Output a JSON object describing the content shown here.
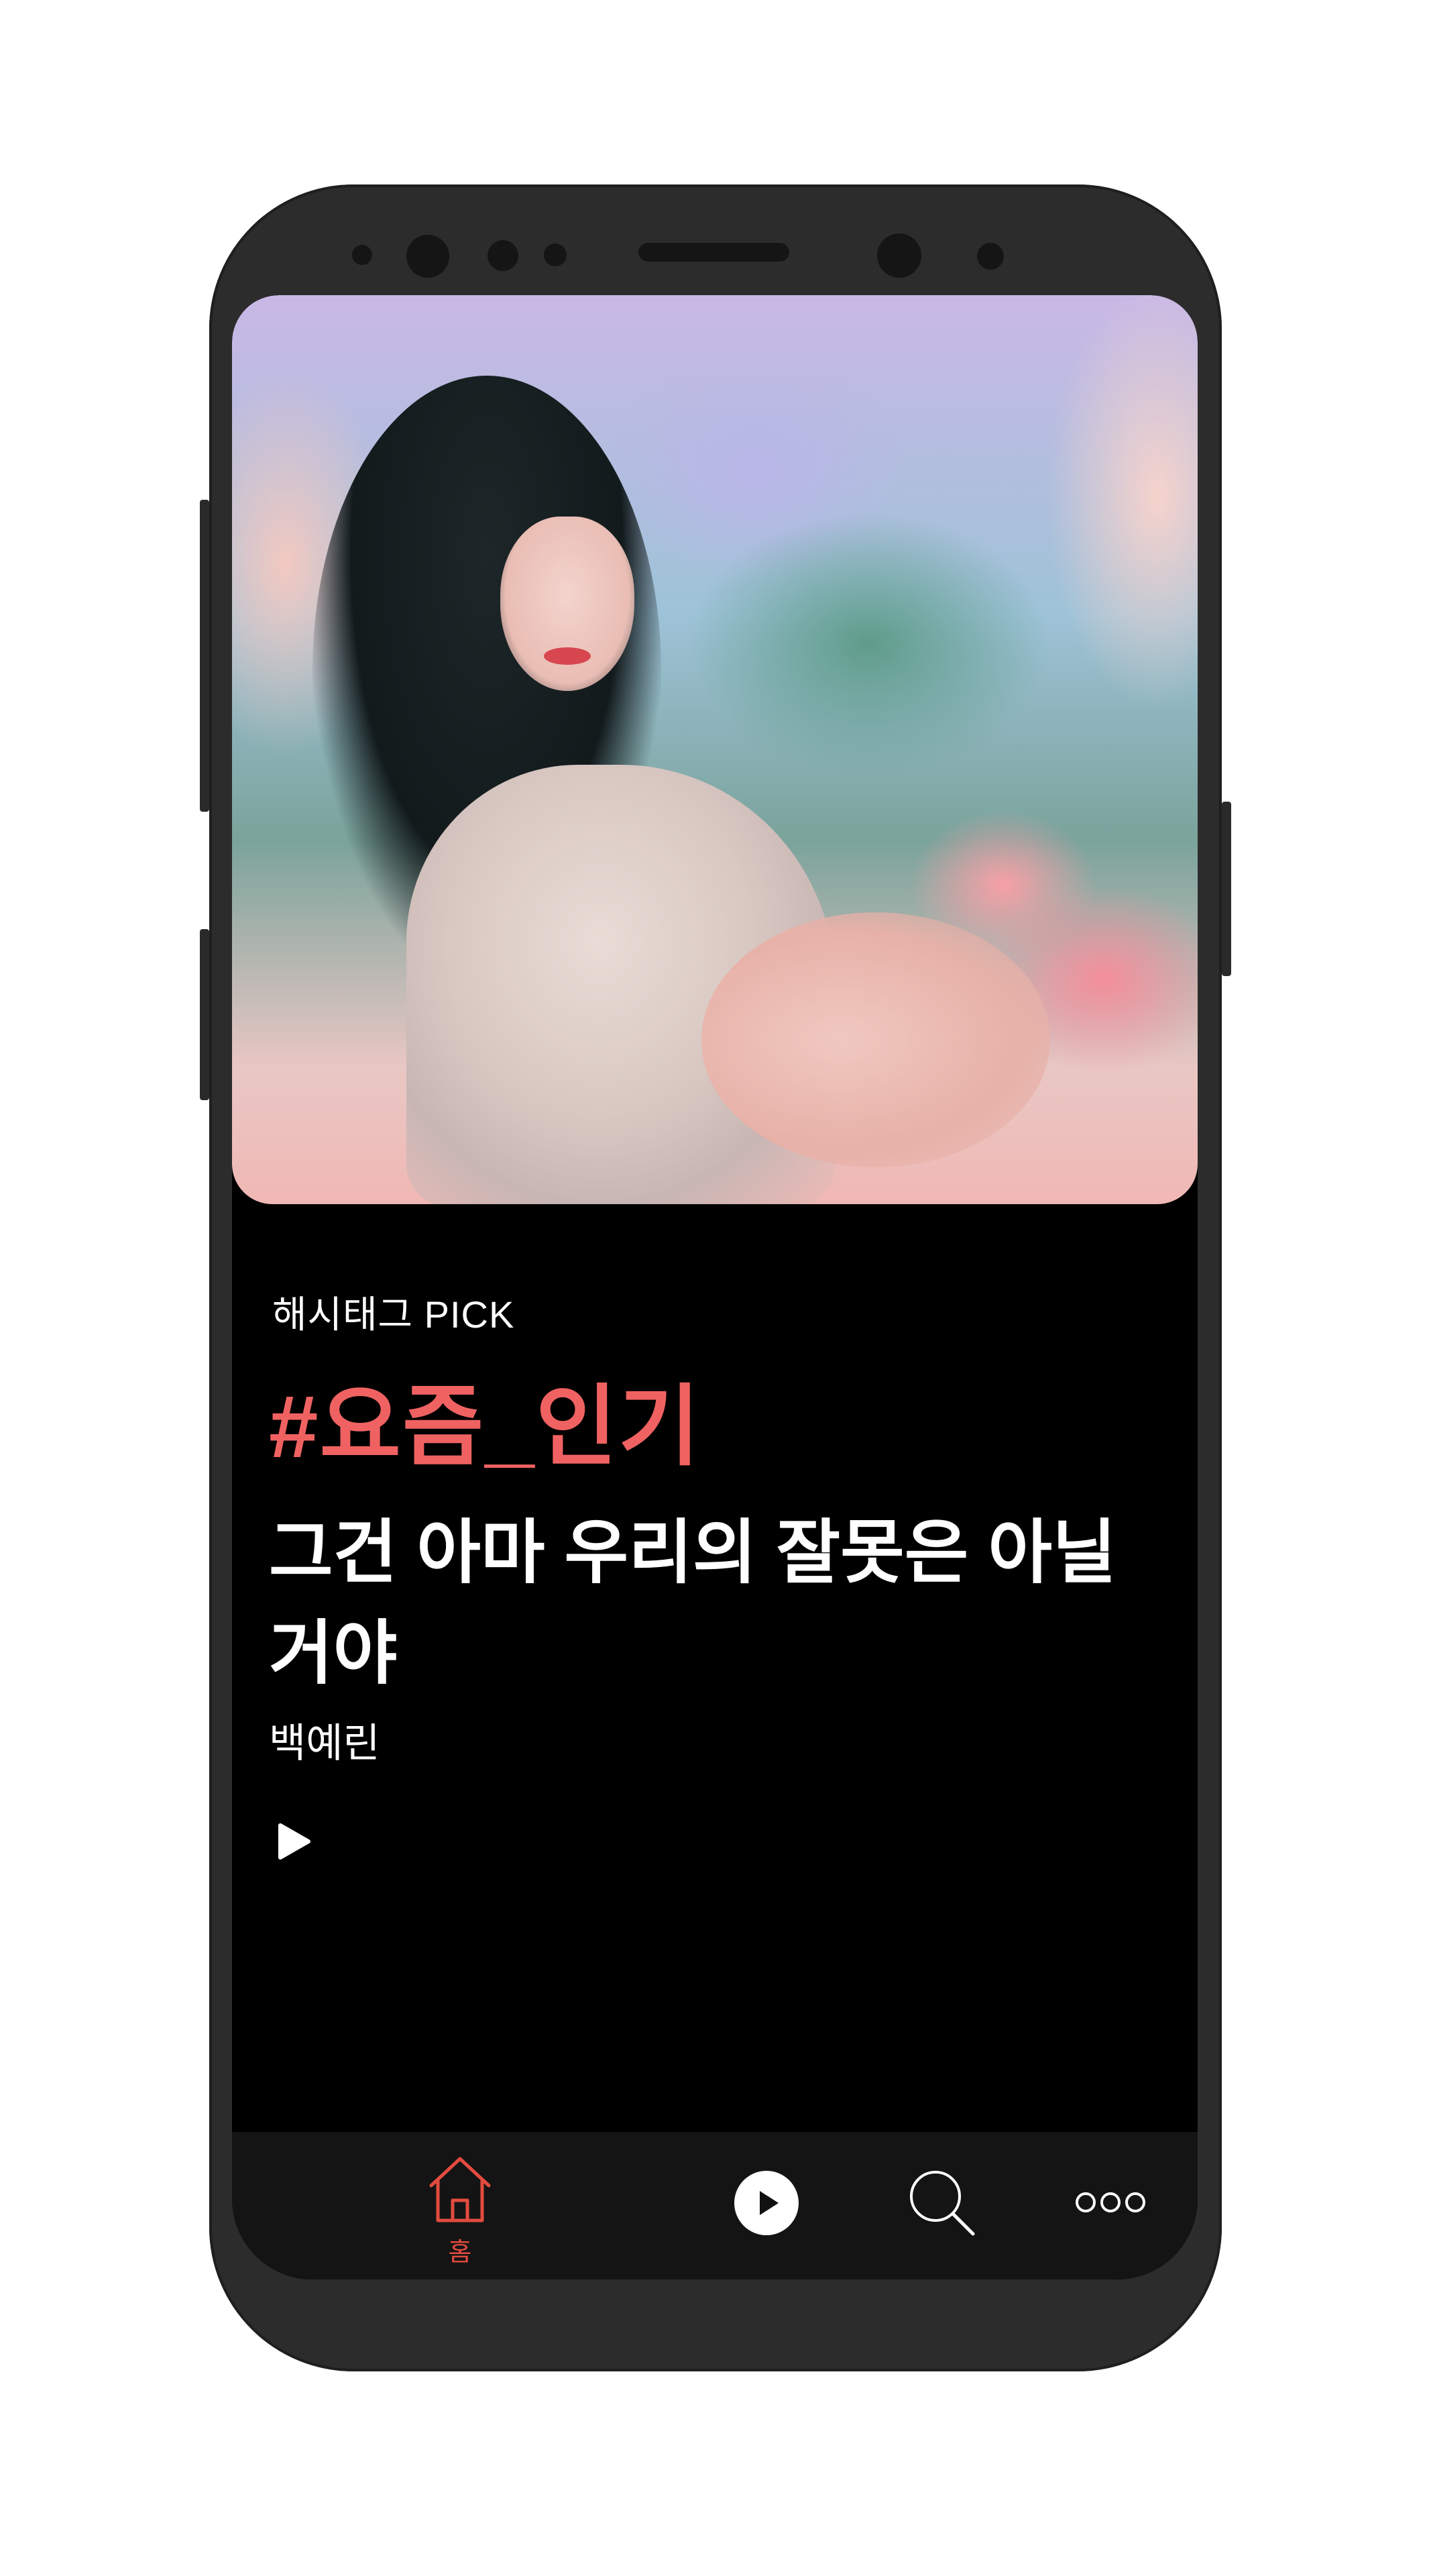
{
  "now_playing": {
    "section_caption": "해시태그 PICK",
    "hashtag": "#요즘_인기",
    "song_title": "그건 아마 우리의 잘못은 아닐 거야",
    "artist": "백예린",
    "play_icon": "play-triangle-icon"
  },
  "bottom_nav": {
    "home": {
      "label": "홈",
      "icon": "home-icon",
      "active": true
    },
    "play": {
      "icon": "play-circle-icon"
    },
    "search": {
      "icon": "search-icon"
    },
    "more": {
      "icon": "more-dots-icon"
    }
  },
  "colors": {
    "accent": "#f06262",
    "nav_active": "#e34b3f",
    "screen_bg": "#000000",
    "nav_bg": "#141414",
    "phone_body": "#2c2c2c"
  }
}
